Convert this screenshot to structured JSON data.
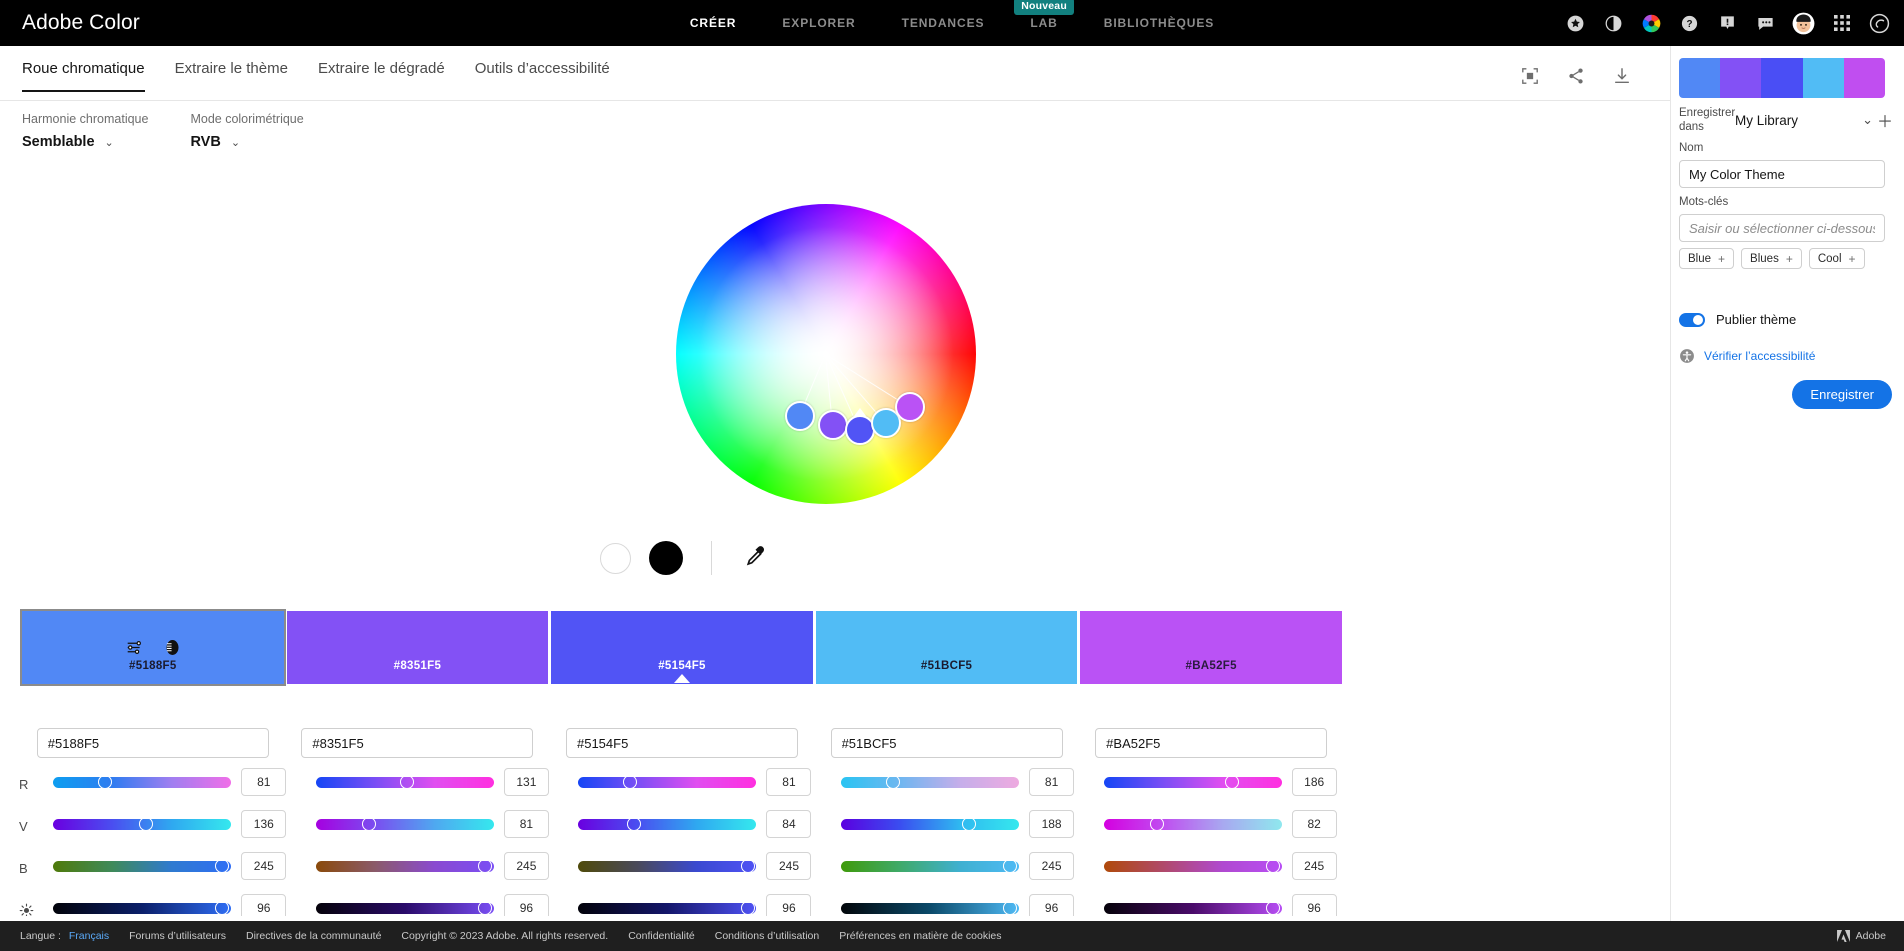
{
  "header": {
    "brand": "Adobe Color",
    "nav": [
      {
        "label": "CRÉER",
        "active": true,
        "badge": null
      },
      {
        "label": "EXPLORER",
        "active": false,
        "badge": null
      },
      {
        "label": "TENDANCES",
        "active": false,
        "badge": null
      },
      {
        "label": "LAB",
        "active": false,
        "badge": "Nouveau"
      },
      {
        "label": "BIBLIOTHÈQUES",
        "active": false,
        "badge": null
      }
    ],
    "icons": [
      "star-badge-icon",
      "contrast-icon",
      "color-wheel-icon",
      "help-icon",
      "notifications-icon",
      "feedback-icon",
      "avatar-icon",
      "app-grid-icon",
      "creative-cloud-icon"
    ]
  },
  "tabs": [
    {
      "label": "Roue chromatique",
      "active": true
    },
    {
      "label": "Extraire le thème",
      "active": false
    },
    {
      "label": "Extraire le dégradé",
      "active": false
    },
    {
      "label": "Outils d’accessibilité",
      "active": false
    }
  ],
  "tool_icons": [
    "fullscreen-icon",
    "share-icon",
    "download-icon"
  ],
  "controls": [
    {
      "label": "Harmonie chromatique",
      "value": "Semblable"
    },
    {
      "label": "Mode colorimétrique",
      "value": "RVB"
    }
  ],
  "bw_row": {
    "white_swatch": "#FFFFFF",
    "black_swatch": "#000000",
    "eyedropper": "eyedropper-icon"
  },
  "swatches": [
    {
      "hex": "#5188F5",
      "label_color": "#1a1a2e",
      "selected": true,
      "base": false,
      "icons": [
        "sliders-icon",
        "contrast-icon"
      ]
    },
    {
      "hex": "#8351F5",
      "label_color": "#ffffff",
      "selected": false,
      "base": false,
      "icons": []
    },
    {
      "hex": "#5154F5",
      "label_color": "#ffffff",
      "selected": false,
      "base": true,
      "icons": []
    },
    {
      "hex": "#51BCF5",
      "label_color": "#1a1a2e",
      "selected": false,
      "base": false,
      "icons": []
    },
    {
      "hex": "#BA52F5",
      "label_color": "#2a1a3e",
      "selected": false,
      "base": false,
      "icons": []
    }
  ],
  "hex_inputs": [
    "#5188F5",
    "#8351F5",
    "#5154F5",
    "#51BCF5",
    "#BA52F5"
  ],
  "slider_rows": [
    {
      "channel": "R",
      "values": [
        81,
        131,
        81,
        81,
        186
      ],
      "gradients": [
        "linear-gradient(90deg,#0d9ef0,#2f7cf0,#a07ef0,#f06fe8)",
        "linear-gradient(90deg,#1546f5,#7a4ef5,#e04ef0,#ff2fe0)",
        "linear-gradient(90deg,#1546f5,#7a4ef5,#e04ef0,#ff2fe0)",
        "linear-gradient(90deg,#29c4f2,#6fb6f0,#c5aeea,#eeaae0)",
        "linear-gradient(90deg,#1546f5,#7a4ef5,#e04ef0,#ff2fe0)"
      ],
      "positions": [
        29,
        51,
        29,
        29,
        72
      ]
    },
    {
      "channel": "V",
      "values": [
        136,
        81,
        84,
        188,
        82
      ],
      "gradients": [
        "linear-gradient(90deg,#6a00e0,#4a4ef0,#2fa8f0,#35e8ee)",
        "linear-gradient(90deg,#a600e0,#7a4ef0,#4fa8f0,#35e8ee)",
        "linear-gradient(90deg,#6a00e0,#4a4ef0,#2fa8f0,#35e8ee)",
        "linear-gradient(90deg,#5a00e0,#3a4ef0,#2fb8f0,#35e8ee)",
        "linear-gradient(90deg,#d400e0,#c04ef0,#a8a8f0,#8fe8ee)"
      ],
      "positions": [
        52,
        30,
        31,
        72,
        30
      ]
    },
    {
      "channel": "B",
      "values": [
        245,
        245,
        245,
        245,
        245
      ],
      "gradients": [
        "linear-gradient(90deg,#4f7a0a,#3f8a5a,#2f7ad0,#2f6ef5)",
        "linear-gradient(90deg,#8a4a0a,#8a5a6a,#8a4ad0,#7a4ef5)",
        "linear-gradient(90deg,#4f4a0a,#4a4a5a,#3a4ad0,#4f52f5)",
        "linear-gradient(90deg,#3f9a0a,#3faa6a,#3fb0d0,#4fbaf5)",
        "linear-gradient(90deg,#b04a0a,#b04a6a,#b04ad0,#b84ef5)"
      ],
      "positions": [
        95,
        95,
        95,
        95,
        95
      ]
    },
    {
      "channel": "brightness-icon",
      "values": [
        96,
        96,
        96,
        96,
        96
      ],
      "gradients": [
        "linear-gradient(90deg,#02030a,#0b1f6a,#2f6ef5)",
        "linear-gradient(90deg,#05020a,#2a0b6a,#7a4ef5)",
        "linear-gradient(90deg,#02020a,#14166a,#4f52f5)",
        "linear-gradient(90deg,#02060a,#0b4a6a,#4fbaf5)",
        "linear-gradient(90deg,#06020a,#4a0b6a,#b84ef5)"
      ],
      "positions": [
        95,
        95,
        95,
        95,
        95
      ]
    }
  ],
  "right_panel": {
    "preview_colors": [
      "#5188F5",
      "#8351F5",
      "#4A4EF5",
      "#51BCF5",
      "#C04EF0"
    ],
    "save_in_label": "Enregistrer dans",
    "library_value": "My Library",
    "library_chevron": "chevron-down-icon",
    "library_add": "plus-icon",
    "name_label": "Nom",
    "name_value": "My Color Theme",
    "keywords_label": "Mots-clés",
    "keywords_placeholder": "Saisir ou sélectionner ci-dessous",
    "tags": [
      "Blue",
      "Blues",
      "Cool"
    ],
    "publish_label": "Publier thème",
    "publish_on": true,
    "accessibility_label": "Vérifier l’accessibilité",
    "accessibility_icon": "accessibility-icon",
    "save_button": "Enregistrer",
    "accent_color": "#1473e6"
  },
  "footer": {
    "lang_label": "Langue :",
    "lang_value": "Français",
    "links": [
      "Forums d’utilisateurs",
      "Directives de la communauté",
      "Copyright © 2023 Adobe. All rights reserved.",
      "Confidentialité",
      "Conditions d’utilisation",
      "Préférences en matière de cookies"
    ],
    "brand": "Adobe"
  }
}
